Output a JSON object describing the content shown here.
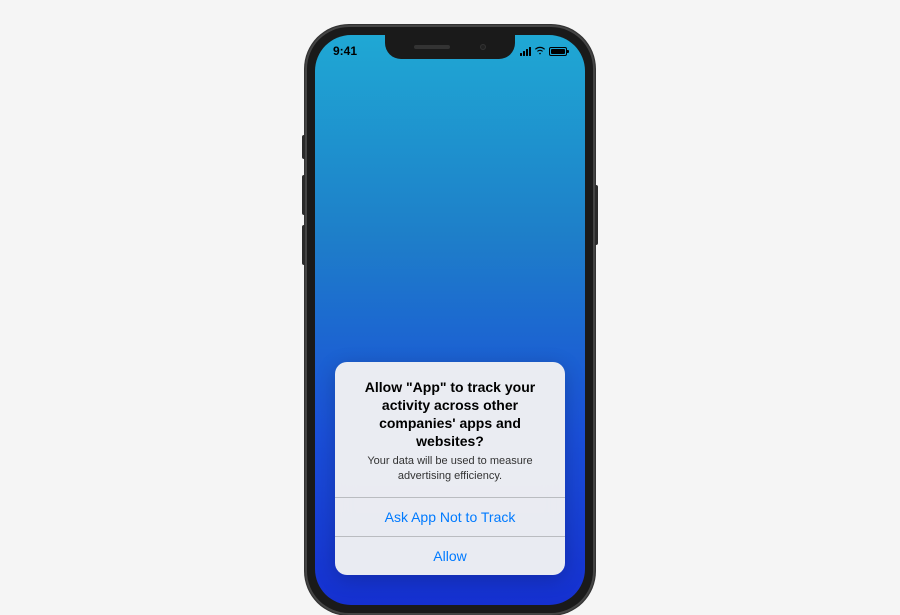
{
  "status_bar": {
    "time": "9:41"
  },
  "dialog": {
    "title": "Allow \"App\" to track your activity across other companies' apps and websites?",
    "message": "Your data will be used to measure advertising efficiency.",
    "primary_button": "Ask App Not to Track",
    "secondary_button": "Allow"
  }
}
